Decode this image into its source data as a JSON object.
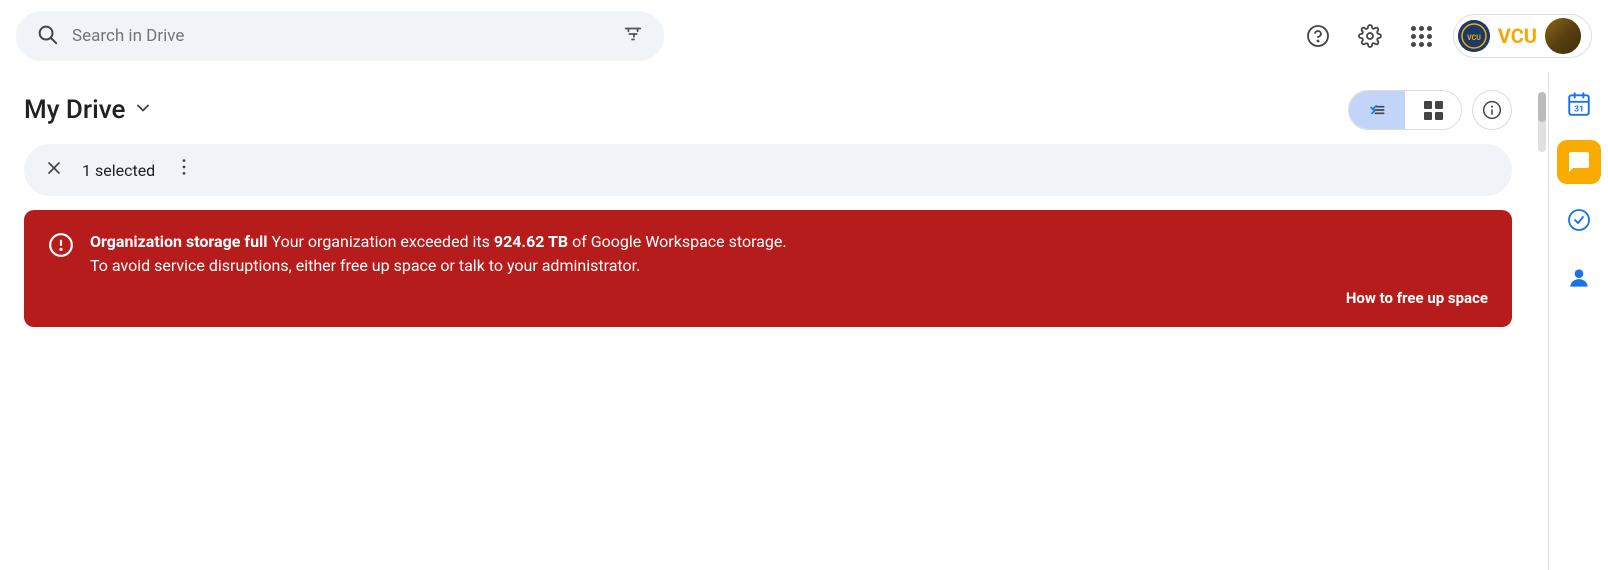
{
  "header": {
    "search_placeholder": "Search in Drive",
    "help_label": "Help",
    "settings_label": "Settings",
    "apps_label": "Google apps",
    "vcu_text": "VCU",
    "account_label": "Account"
  },
  "page": {
    "title": "My Drive",
    "title_dropdown_label": "My Drive dropdown"
  },
  "view_controls": {
    "list_view_label": "List view",
    "grid_view_label": "Grid view",
    "info_label": "View details"
  },
  "selection_bar": {
    "selected_text": "1 selected",
    "close_label": "Deselect",
    "more_label": "More actions"
  },
  "alert": {
    "icon": "!",
    "title": "Organization storage full",
    "body": " Your organization exceeded its ",
    "storage_amount": "924.62 TB",
    "body2": " of Google Workspace storage.",
    "line2": "To avoid service disruptions, either free up space or talk to your administrator.",
    "link_text": "How to free up space"
  },
  "right_sidebar": {
    "calendar_label": "Google Calendar",
    "chat_label": "Google Chat",
    "tasks_label": "Google Tasks",
    "people_label": "Google Contacts"
  }
}
